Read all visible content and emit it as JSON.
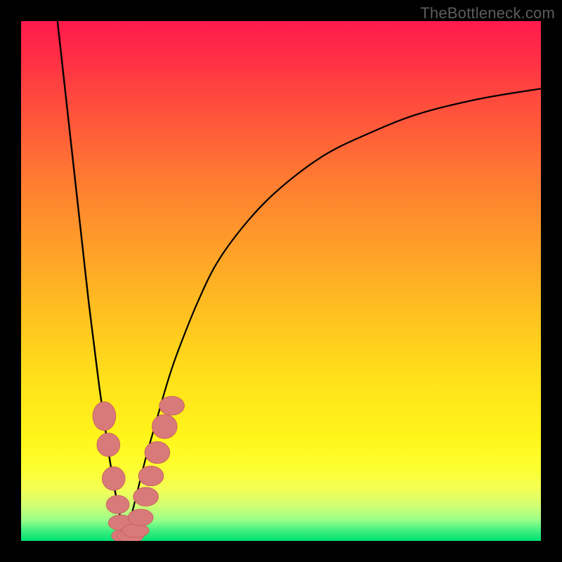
{
  "watermark": "TheBottleneck.com",
  "colors": {
    "frame": "#000000",
    "curve": "#000000",
    "marker_fill": "#d97a7a",
    "marker_stroke": "#c96262",
    "gradient_stops": [
      "#ff1a4d",
      "#ff2b45",
      "#ff4040",
      "#ff6038",
      "#ff8030",
      "#ffa028",
      "#ffc020",
      "#ffdf1a",
      "#fff51a",
      "#fdff30",
      "#f3ff55",
      "#d4ff70",
      "#9aff88",
      "#40f080",
      "#00e070"
    ]
  },
  "chart_data": {
    "type": "line",
    "title": "",
    "xlabel": "",
    "ylabel": "",
    "xlim": [
      0,
      100
    ],
    "ylim": [
      0,
      100
    ],
    "x_optimum": 20,
    "note": "V-shaped bottleneck-percentage curve. y≈0 at x≈20, rising steeply toward 100 on both sides; right arm asymptotes below 100.",
    "series": [
      {
        "name": "left-arm",
        "x": [
          7,
          8,
          9,
          10,
          11,
          12,
          13,
          14,
          15,
          16,
          17,
          18,
          19,
          20
        ],
        "y": [
          100,
          91,
          82,
          73,
          64,
          55,
          46,
          38,
          30,
          23,
          16,
          10,
          5,
          0
        ]
      },
      {
        "name": "right-arm",
        "x": [
          20,
          22,
          24,
          26,
          28,
          30,
          34,
          38,
          44,
          50,
          58,
          66,
          76,
          88,
          100
        ],
        "y": [
          0,
          8,
          16,
          23,
          30,
          36,
          46,
          54,
          62,
          68,
          74,
          78,
          82,
          85,
          87
        ]
      }
    ],
    "markers": {
      "name": "sample-points",
      "note": "salmon capsule/oval markers near the valley",
      "points": [
        {
          "x": 16.0,
          "y": 24.0,
          "w": 2.2,
          "h": 5.5
        },
        {
          "x": 16.8,
          "y": 18.5,
          "w": 2.2,
          "h": 4.5
        },
        {
          "x": 17.8,
          "y": 12.0,
          "w": 2.2,
          "h": 4.5
        },
        {
          "x": 18.6,
          "y": 7.0,
          "w": 2.2,
          "h": 3.5
        },
        {
          "x": 19.2,
          "y": 3.5,
          "w": 2.4,
          "h": 3.0
        },
        {
          "x": 20.0,
          "y": 1.0,
          "w": 2.6,
          "h": 2.6
        },
        {
          "x": 21.0,
          "y": 1.0,
          "w": 2.6,
          "h": 2.6
        },
        {
          "x": 22.0,
          "y": 2.0,
          "w": 2.6,
          "h": 2.6
        },
        {
          "x": 23.0,
          "y": 4.5,
          "w": 2.4,
          "h": 3.2
        },
        {
          "x": 24.0,
          "y": 8.5,
          "w": 2.4,
          "h": 3.6
        },
        {
          "x": 25.0,
          "y": 12.5,
          "w": 2.4,
          "h": 3.8
        },
        {
          "x": 26.2,
          "y": 17.0,
          "w": 2.4,
          "h": 4.2
        },
        {
          "x": 27.6,
          "y": 22.0,
          "w": 2.4,
          "h": 4.6
        },
        {
          "x": 29.0,
          "y": 26.0,
          "w": 2.4,
          "h": 3.6
        }
      ]
    }
  }
}
